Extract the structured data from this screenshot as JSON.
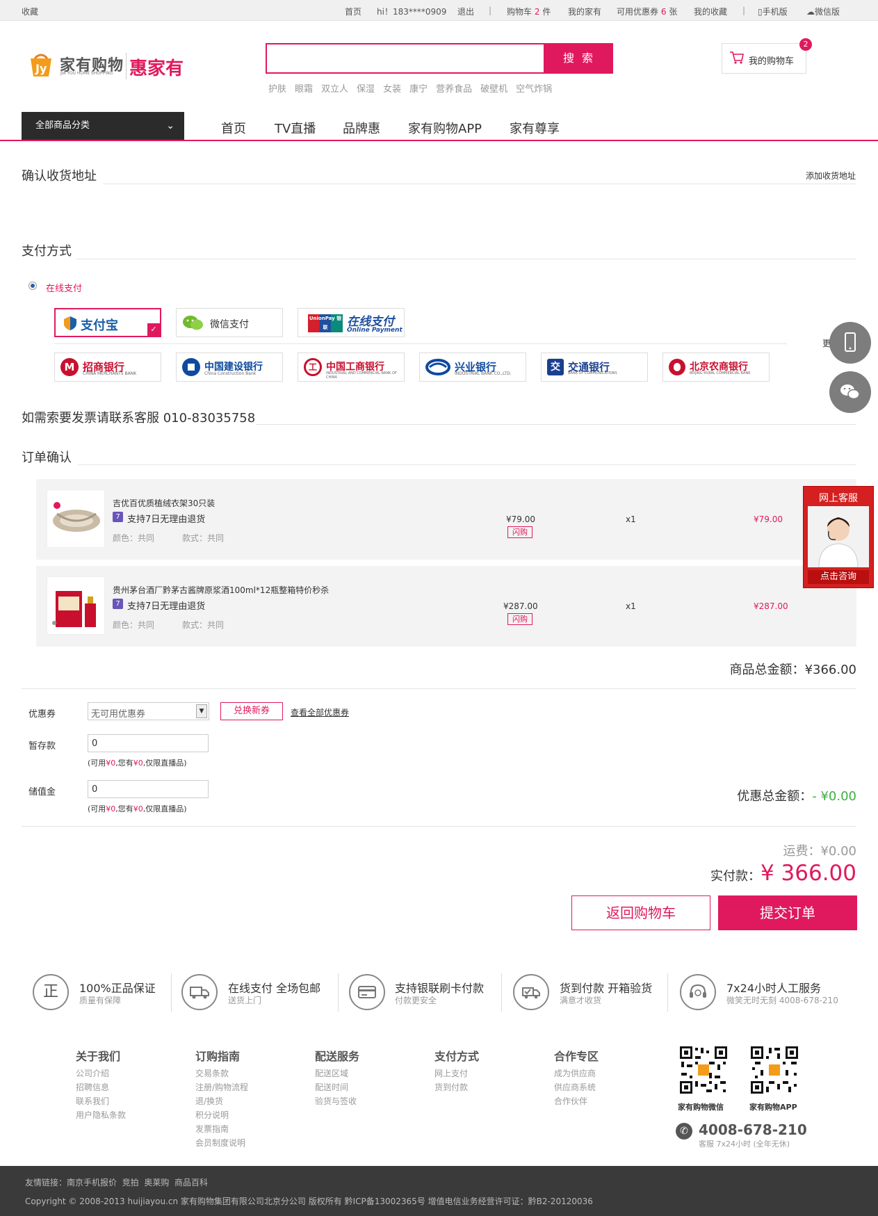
{
  "topbar": {
    "favorite": "收藏",
    "home": "首页",
    "greeting": "hi！183****0909",
    "logout": "退出",
    "sep": "|",
    "cart_label": "购物车",
    "cart_count": "2",
    "cart_unit": "件",
    "my_home": "我的家有",
    "coupon_label": "可用优惠券",
    "coupon_count": "6",
    "coupon_unit": "张",
    "my_favorites": "我的收藏",
    "mobile": "手机版",
    "wechat": "微信版"
  },
  "header": {
    "logo_cn": "家有购物",
    "logo_en": "JIA YOU HOME SHOPPING",
    "logo_brand": "惠家有",
    "search_button": "搜 索",
    "search_value": "",
    "hot_keywords": [
      "护肤",
      "眼霜",
      "双立人",
      "保湿",
      "女装",
      "康宁",
      "营养食品",
      "破壁机",
      "空气炸锅"
    ],
    "cart_button": "我的购物车",
    "cart_badge": "2"
  },
  "nav": {
    "category": "全部商品分类",
    "items": [
      "首页",
      "TV直播",
      "品牌惠",
      "家有购物APP",
      "家有尊享"
    ]
  },
  "address": {
    "title": "确认收货地址",
    "add": "添加收货地址"
  },
  "payment": {
    "title": "支付方式",
    "online": "在线支付",
    "more": "更多",
    "methods": [
      {
        "name": "支付宝",
        "selected": true
      },
      {
        "name": "微信支付",
        "selected": false
      },
      {
        "name": "在线支付",
        "sub": "Online Payment",
        "badge": "UnionPay 银联",
        "selected": false
      }
    ],
    "banks": [
      {
        "name": "招商银行",
        "en": "CHINA MERCHANTS BANK",
        "color": "#c8102e"
      },
      {
        "name": "中国建设银行",
        "en": "China Construction Bank",
        "color": "#0d4a9e"
      },
      {
        "name": "中国工商银行",
        "en": "INDUSTRIAL AND COMMERCIAL BANK OF CHINA",
        "color": "#c8102e"
      },
      {
        "name": "兴业银行",
        "en": "INDUSTRIAL BANK CO.,LTD.",
        "color": "#0d4a9e"
      },
      {
        "name": "交通银行",
        "en": "BANK OF COMMUNICATIONS",
        "color": "#1b3f8f"
      },
      {
        "name": "北京农商银行",
        "en": "BEIJING RURAL COMMERCIAL BANK",
        "color": "#c8102e"
      }
    ]
  },
  "invoice": {
    "title": "如需索要发票请联系客服 010-83035758"
  },
  "order": {
    "title": "订单确认",
    "items": [
      {
        "name": "吉优百优质植绒衣架30只装",
        "return_policy": "支持7日无理由退货",
        "tag": "7",
        "color": "颜色：共同",
        "style": "款式：共同",
        "price": "¥79.00",
        "flash": "闪购",
        "qty": "x1",
        "subtotal": "¥79.00"
      },
      {
        "name": "贵州茅台酒厂黔茅古酱牌原浆酒100ml*12瓶整箱特价秒杀",
        "return_policy": "支持7日无理由退货",
        "tag": "7",
        "color": "颜色：共同",
        "style": "款式：共同",
        "price": "¥287.00",
        "flash": "闪购",
        "qty": "x1",
        "subtotal": "¥287.00"
      }
    ],
    "total_label": "商品总金额：",
    "total_value": "¥366.00"
  },
  "discount": {
    "coupon_label": "优惠券",
    "coupon_select": "无可用优惠券",
    "exchange": "兑换新券",
    "view_all": "查看全部优惠券",
    "deposit_label": "暂存款",
    "deposit_value": "0",
    "deposit_hint_pre": "(可用",
    "deposit_hint_a": "¥0",
    "deposit_hint_mid": ",您有",
    "deposit_hint_b": "¥0",
    "deposit_hint_post": ",仅限直播品)",
    "stored_label": "储值金",
    "stored_value": "0",
    "discount_total_label": "优惠总金额：",
    "discount_total_value": "- ¥0.00"
  },
  "summary": {
    "shipping_label": "运费：",
    "shipping_value": "¥0.00",
    "pay_label": "实付款：",
    "pay_value": "¥ 366.00",
    "back": "返回购物车",
    "submit": "提交订单"
  },
  "guarantees": [
    {
      "icon": "正",
      "title": "100%正品保证",
      "sub": "质量有保障"
    },
    {
      "icon": "truck",
      "title": "在线支付 全场包邮",
      "sub": "送货上门"
    },
    {
      "icon": "card",
      "title": "支持银联刷卡付款",
      "sub": "付款更安全"
    },
    {
      "icon": "delivery",
      "title": "货到付款 开箱验货",
      "sub": "满意才收货"
    },
    {
      "icon": "headset",
      "title": "7x24小时人工服务",
      "sub": "微笑无时无刻 4008-678-210"
    }
  ],
  "footer": {
    "columns": [
      {
        "title": "关于我们",
        "links": [
          "公司介绍",
          "招聘信息",
          "联系我们",
          "用户隐私条款"
        ]
      },
      {
        "title": "订购指南",
        "links": [
          "交易条款",
          "注册/购物流程",
          "退/换货",
          "积分说明",
          "发票指南",
          "会员制度说明"
        ]
      },
      {
        "title": "配送服务",
        "links": [
          "配送区域",
          "配送时间",
          "验货与签收"
        ]
      },
      {
        "title": "支付方式",
        "links": [
          "网上支付",
          "货到付款"
        ]
      },
      {
        "title": "合作专区",
        "links": [
          "成为供应商",
          "供应商系统",
          "合作伙伴"
        ]
      }
    ],
    "qr_wechat": "家有购物微信",
    "qr_app": "家有购物APP",
    "phone": "4008-678-210",
    "phone_sub": "客服 7x24小时 (全年无休)",
    "friend_links_label": "友情链接：",
    "friend_links": [
      "南京手机报价",
      "竞拍",
      "奥莱购",
      "商品百科"
    ],
    "copyright": "Copyright © 2008-2013 huijiayou.cn 家有购物集团有限公司北京分公司 版权所有 黔ICP备13002365号 增值电信业务经营许可证：黔B2-20120036"
  },
  "float": {
    "service_title": "网上客服",
    "service_btn": "点击咨询"
  }
}
